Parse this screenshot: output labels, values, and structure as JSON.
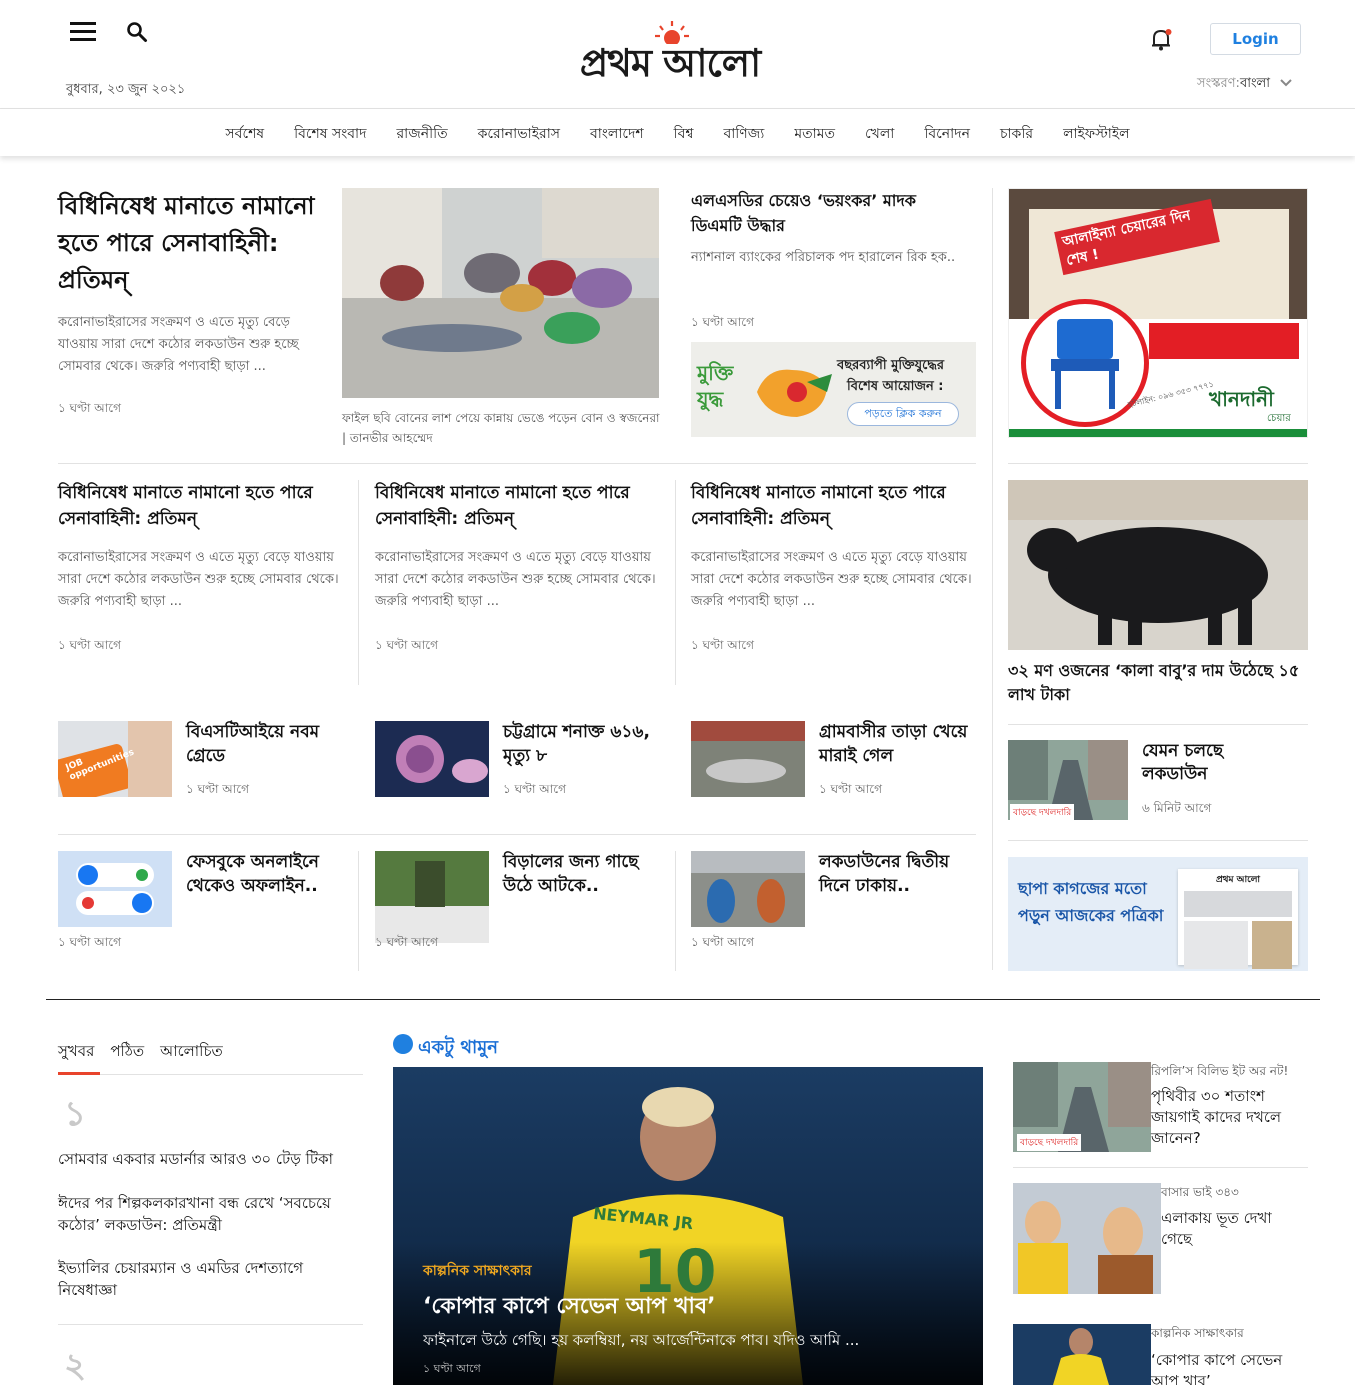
{
  "header": {
    "date": "বুধবার, ২৩ জুন ২০২১",
    "logo_text": "প্রথম আলো",
    "login_label": "Login",
    "edition_label": "সংস্করণ:",
    "edition_value": "বাংলা"
  },
  "nav": [
    "সর্বশেষ",
    "বিশেষ সংবাদ",
    "রাজনীতি",
    "করোনাভাইরাস",
    "বাংলাদেশ",
    "বিশ্ব",
    "বাণিজ্য",
    "মতামত",
    "খেলা",
    "বিনোদন",
    "চাকরি",
    "লাইফস্টাইল"
  ],
  "lead": {
    "headline": "বিধিনিষেধ মানাতে নামানো হতে পারে সেনাবাহিনী: প্রতিমন্",
    "summary": "করোনাভাইরাসের সংক্রমণ ও এতে মৃত্যু বেড়ে যাওয়ায় সারা দেশে কঠোর লকডাউন শুরু হচ্ছে সোমবার থেকে। জরুরি পণ্যবাহী ছাড়া ...",
    "time": "১ ঘণ্টা আগে",
    "caption": "ফাইল ছবি বোনের লাশ পেয়ে কান্নায় ভেঙে পড়েন বোন ও স্বজনেরা | তানভীর আহম্মেদ"
  },
  "side_story": {
    "headline": "এলএসডির চেয়েও ‘ভয়ংকর’ মাদক ডিএমটি উদ্ধার",
    "summary": "ন্যাশনাল ব্যাংকের পরিচালক পদ হারালেন রিক হক..",
    "time": "১ ঘণ্টা আগে"
  },
  "mukti_ad": {
    "logo_text": "মুক্তি যুদ্ধ",
    "line1": "বছরব্যাপী মুক্তিযুদ্ধের",
    "line2": "বিশেষ আয়োজন :",
    "button": "পড়তে ক্লিক করুন"
  },
  "chair_ad": {
    "tagline": "আলাইন্যা চেয়ারের দিন শেষ !",
    "brand": "খানদানী",
    "brand_sub": "চেয়ার",
    "phone": "হটলাইন: ০৯৬ ৩৫৩ ৭৭৭১"
  },
  "row2": [
    {
      "headline": "বিধিনিষেধ মানাতে নামানো হতে পারে সেনাবাহিনী: প্রতিমন্",
      "summary": "করোনাভাইরাসের সংক্রমণ ও এতে মৃত্যু বেড়ে যাওয়ায় সারা দেশে কঠোর লকডাউন শুরু হচ্ছে সোমবার থেকে। জরুরি পণ্যবাহী ছাড়া ...",
      "time": "১ ঘণ্টা আগে"
    },
    {
      "headline": "বিধিনিষেধ মানাতে নামানো হতে পারে সেনাবাহিনী: প্রতিমন্",
      "summary": "করোনাভাইরাসের সংক্রমণ ও এতে মৃত্যু বেড়ে যাওয়ায় সারা দেশে কঠোর লকডাউন শুরু হচ্ছে সোমবার থেকে। জরুরি পণ্যবাহী ছাড়া ...",
      "time": "১ ঘণ্টা আগে"
    },
    {
      "headline": "বিধিনিষেধ মানাতে নামানো হতে পারে সেনাবাহিনী: প্রতিমন্",
      "summary": "করোনাভাইরাসের সংক্রমণ ও এতে মৃত্যু বেড়ে যাওয়ায় সারা দেশে কঠোর লকডাউন শুরু হচ্ছে সোমবার থেকে। জরুরি পণ্যবাহী ছাড়া ...",
      "time": "১ ঘণ্টা আগে"
    }
  ],
  "row3": [
    {
      "headline": "বিএসটিআইয়ে নবম গ্রেডে",
      "time": "১ ঘণ্টা আগে",
      "img_text": "JOB opportunities"
    },
    {
      "headline": "চট্টগ্রামে শনাক্ত ৬১৬, মৃত্যু ৮",
      "time": "১ ঘণ্টা আগে"
    },
    {
      "headline": "গ্রামবাসীর তাড়া খেয়ে মারাই গেল",
      "time": "১ ঘণ্টা আগে"
    }
  ],
  "row4": [
    {
      "headline": "ফেসবুকে অনলাইনে থেকেও অফলাইন..",
      "time": "১ ঘণ্টা আগে"
    },
    {
      "headline": "বিড়ালের জন্য গাছে উঠে আটকে..",
      "time": "১ ঘণ্টা আগে"
    },
    {
      "headline": "লকডাউনের দ্বিতীয় দিনে ঢাকায়..",
      "time": "১ ঘণ্টা আগে"
    }
  ],
  "right": {
    "cow_headline": "৩২ মণ ওজনের ‘কালা বাবু’র দাম উঠেছে ১৫ লাখ টাকা",
    "lockdown_headline": "যেমন চলছে লকডাউন",
    "lockdown_time": "৬ মিনিট আগে",
    "lockdown_badge": "বাড়ছে দখলদারি",
    "epaper_text": "ছাপা কাগজের মতো পড়ুন আজকের পত্রিকা",
    "epaper_mast": "প্রথম আলো"
  },
  "tabs": [
    "সুখবর",
    "পঠিত",
    "আলোচিত"
  ],
  "ranked": {
    "num1": "১",
    "items": [
      "সোমবার একবার মডার্নার আরও ৩০ টেড় টিকা",
      "ঈদের পর শিল্পকলকারখানা বন্ধ রেখে ‘সবচেয়ে কঠোর’ লকডাউন: প্রতিমন্ত্রী",
      "ইভ্যালির চেয়ারম্যান ও এমডির দেশত্যাগে নিষেধাজ্ঞা"
    ],
    "num2": "২"
  },
  "featured": {
    "section": "একটু থামুন",
    "kicker": "কাল্পনিক সাক্ষাৎকার",
    "headline": "‘কোপার কাপে সেভেন আপ খাব’",
    "summary": "ফাইনালে উঠে গেছি। হয় কলম্বিয়া, নয় আর্জেন্টিনাকে পাব। যদিও আমি ...",
    "time": "১ ঘণ্টা আগে",
    "jersey": "NEYMAR JR",
    "number": "10"
  },
  "right2": [
    {
      "kicker": "রিপলি’স বিলিভ ইট অর নট!",
      "headline": "পৃথিবীর ৩০ শতাংশ জায়গাই কাদের দখলে জানেন?",
      "badge": "বাড়ছে দখলদারি"
    },
    {
      "kicker": "বাসার ভাই ৩৪৩",
      "headline": "এলাকায় ভূত দেখা গেছে"
    },
    {
      "kicker": "কাল্পনিক সাক্ষাৎকার",
      "headline": "‘কোপার কাপে সেভেন আপ খাব’"
    }
  ],
  "colors": {
    "accent": "#e8442c",
    "blue": "#1f80e0",
    "link_blue": "#1a6fd6"
  }
}
